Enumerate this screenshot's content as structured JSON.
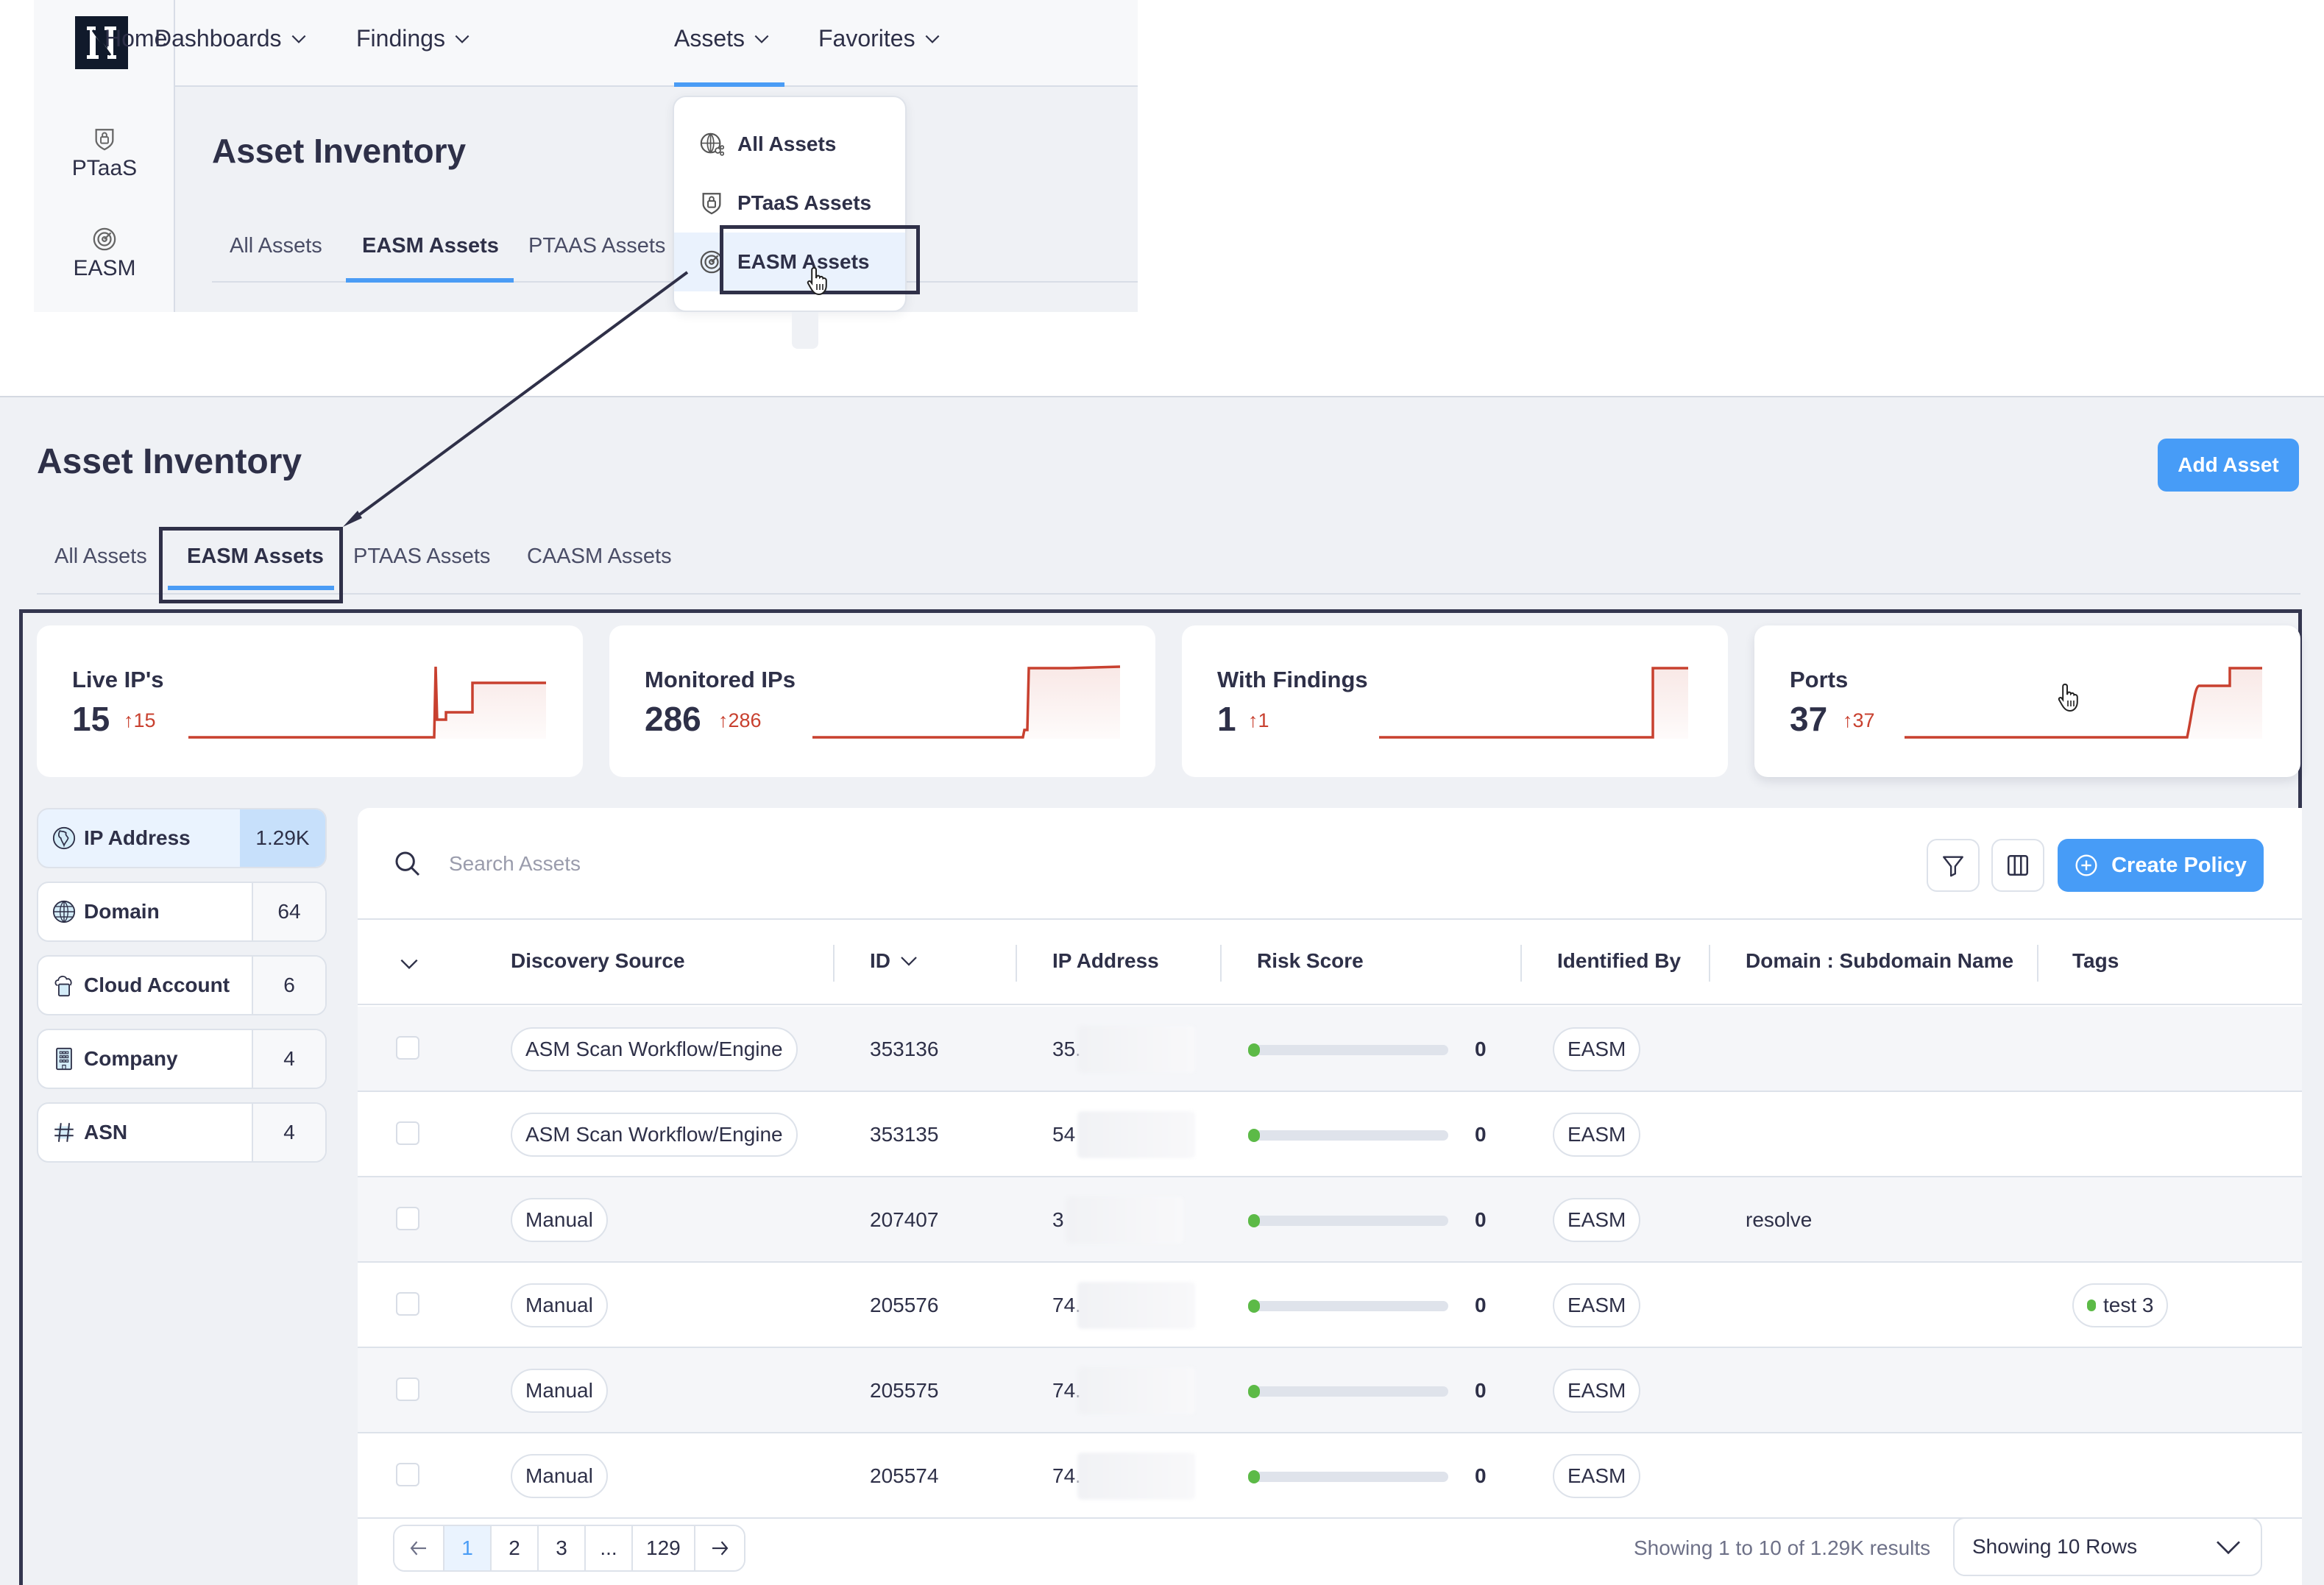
{
  "inset": {
    "logo_letter": "N",
    "nav": [
      {
        "label": "Home",
        "has_menu": false
      },
      {
        "label": "Dashboards",
        "has_menu": true
      },
      {
        "label": "Findings",
        "has_menu": true
      },
      {
        "label": "Assets",
        "has_menu": true,
        "active": true
      },
      {
        "label": "Favorites",
        "has_menu": true
      }
    ],
    "sidebar": [
      {
        "label": "PTaaS",
        "icon": "shield-lock-icon"
      },
      {
        "label": "EASM",
        "icon": "radar-target-icon"
      }
    ],
    "page_title": "Asset Inventory",
    "tabs": [
      "All Assets",
      "EASM Assets",
      "PTAAS Assets"
    ],
    "active_tab": "EASM Assets",
    "assets_menu": [
      {
        "label": "All Assets",
        "icon": "globe-network-icon"
      },
      {
        "label": "PTaaS Assets",
        "icon": "shield-lock-icon"
      },
      {
        "label": "EASM Assets",
        "icon": "radar-target-icon",
        "highlighted": true
      }
    ]
  },
  "page": {
    "title": "Asset Inventory",
    "add_asset_label": "Add Asset",
    "tabs": [
      "All Assets",
      "EASM Assets",
      "PTAAS Assets",
      "CAASM Assets"
    ],
    "active_tab": "EASM Assets"
  },
  "stats": [
    {
      "label": "Live IP's",
      "value": "15",
      "delta": "15"
    },
    {
      "label": "Monitored IPs",
      "value": "286",
      "delta": "286"
    },
    {
      "label": "With Findings",
      "value": "1",
      "delta": "1"
    },
    {
      "label": "Ports",
      "value": "37",
      "delta": "37"
    }
  ],
  "asset_types": [
    {
      "label": "IP Address",
      "count": "1.29K",
      "icon": "globe-africa-icon",
      "active": true
    },
    {
      "label": "Domain",
      "count": "64",
      "icon": "globe-icon"
    },
    {
      "label": "Cloud Account",
      "count": "6",
      "icon": "cloud-server-icon"
    },
    {
      "label": "Company",
      "count": "4",
      "icon": "building-icon"
    },
    {
      "label": "ASN",
      "count": "4",
      "icon": "hash-icon"
    }
  ],
  "table": {
    "search_placeholder": "Search Assets",
    "create_policy_label": "Create Policy",
    "columns": [
      "Discovery Source",
      "ID",
      "IP Address",
      "Risk Score",
      "Identified By",
      "Domain : Subdomain Name",
      "Tags"
    ],
    "rows": [
      {
        "source": "ASM Scan Workflow/Engine",
        "id": "353136",
        "ip": "35.",
        "risk": "0",
        "identified_by": "EASM",
        "domain": "",
        "tag": ""
      },
      {
        "source": "ASM Scan Workflow/Engine",
        "id": "353135",
        "ip": "54",
        "risk": "0",
        "identified_by": "EASM",
        "domain": "",
        "tag": ""
      },
      {
        "source": "Manual",
        "id": "207407",
        "ip": "3",
        "risk": "0",
        "identified_by": "EASM",
        "domain": "resolve",
        "tag": ""
      },
      {
        "source": "Manual",
        "id": "205576",
        "ip": "74.",
        "risk": "0",
        "identified_by": "EASM",
        "domain": "",
        "tag": "test 3"
      },
      {
        "source": "Manual",
        "id": "205575",
        "ip": "74.",
        "risk": "0",
        "identified_by": "EASM",
        "domain": "",
        "tag": ""
      },
      {
        "source": "Manual",
        "id": "205574",
        "ip": "74.",
        "risk": "0",
        "identified_by": "EASM",
        "domain": "",
        "tag": ""
      }
    ],
    "pagination": {
      "pages": [
        "1",
        "2",
        "3",
        "...",
        "129"
      ],
      "current": "1"
    },
    "results_text": "Showing 1 to 10 of 1.29K results",
    "rows_select": "Showing 10 Rows"
  },
  "colors": {
    "accent": "#479cf7",
    "trend": "#c8402f",
    "risk_low": "#5cba47",
    "annotation": "#2f3048"
  }
}
